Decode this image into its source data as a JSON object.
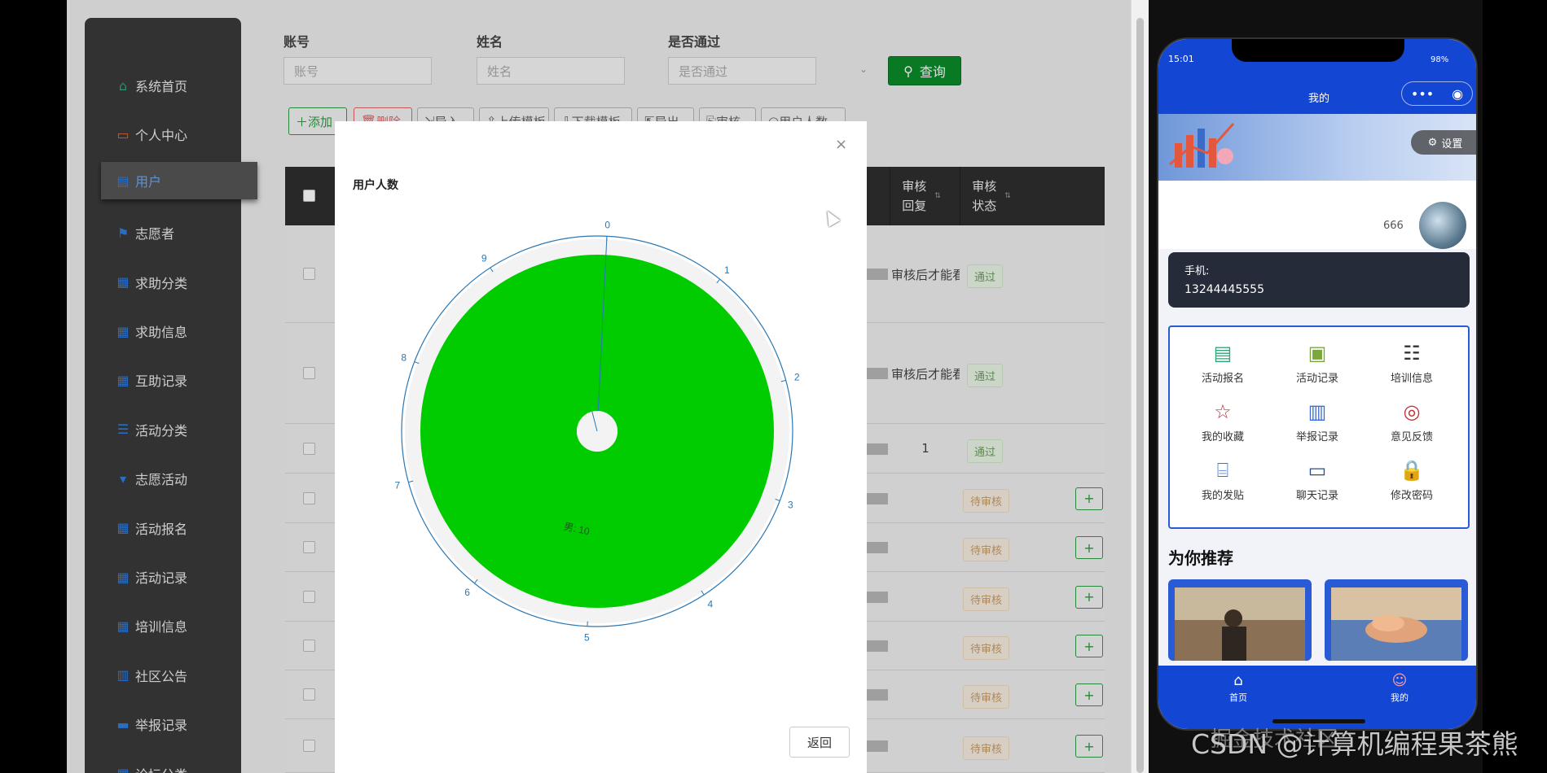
{
  "admin": {
    "sidebar": {
      "items": [
        {
          "label": "系统首页",
          "icon": "home-icon"
        },
        {
          "label": "个人中心",
          "icon": "id-card-icon"
        },
        {
          "label": "用户",
          "icon": "briefcase-icon"
        },
        {
          "label": "志愿者",
          "icon": "flag-icon"
        },
        {
          "label": "求助分类",
          "icon": "grid-icon"
        },
        {
          "label": "求助信息",
          "icon": "grid-icon"
        },
        {
          "label": "互助记录",
          "icon": "grid-icon"
        },
        {
          "label": "活动分类",
          "icon": "sliders-icon"
        },
        {
          "label": "志愿活动",
          "icon": "badge-icon"
        },
        {
          "label": "活动报名",
          "icon": "grid-icon"
        },
        {
          "label": "活动记录",
          "icon": "grid-icon"
        },
        {
          "label": "培训信息",
          "icon": "grid-icon"
        },
        {
          "label": "社区公告",
          "icon": "bar-chart-icon"
        },
        {
          "label": "举报记录",
          "icon": "monitor-icon"
        },
        {
          "label": "论坛分类",
          "icon": "grid-icon"
        }
      ]
    },
    "filters": {
      "account_label": "账号",
      "account_placeholder": "账号",
      "name_label": "姓名",
      "name_placeholder": "姓名",
      "pass_label": "是否通过",
      "pass_placeholder": "是否通过",
      "search_label": "查询"
    },
    "toolbar": {
      "add": "添加",
      "delete": "删除",
      "import": "导入",
      "upload_template": "上传模板",
      "download_template": "下载模板",
      "export": "导出",
      "audit": "审核",
      "user_count": "用户人数"
    },
    "table": {
      "headers": {
        "audit_reply": "审核回复",
        "audit_status": "审核状态"
      },
      "rows": [
        {
          "reply": "审核后才能看",
          "status": "通过"
        },
        {
          "reply": "审核后才能看",
          "status": "通过"
        },
        {
          "reply": "1",
          "status": "通过"
        },
        {
          "reply": "",
          "status": "待审核"
        },
        {
          "reply": "",
          "status": "待审核"
        },
        {
          "reply": "",
          "status": "待审核"
        },
        {
          "reply": "",
          "status": "待审核"
        },
        {
          "reply": "",
          "status": "待审核"
        },
        {
          "reply": "",
          "status": "待审核"
        }
      ]
    }
  },
  "modal": {
    "title": "用户人数",
    "close": "×",
    "back": "返回"
  },
  "chart_data": {
    "type": "pie",
    "title": "用户人数",
    "categories": [
      "男"
    ],
    "values": [
      10
    ],
    "slice_label": "男: 10",
    "angle_axis_ticks": [
      "0",
      "1",
      "2",
      "3",
      "4",
      "5",
      "6",
      "7",
      "8",
      "9"
    ],
    "slice_color": "#00cc00",
    "axis_color": "#2a78b5"
  },
  "phone": {
    "time": "15:01",
    "battery": "98%",
    "title": "我的",
    "capsule_more": "•••",
    "capsule_close": "◉",
    "settings": "设置",
    "username": "666",
    "phone_label": "手机:",
    "phone_value": "13244445555",
    "menu": [
      {
        "label": "活动报名",
        "icon": "document-icon",
        "color": "#2fa57a"
      },
      {
        "label": "活动记录",
        "icon": "bag-icon",
        "color": "#7aa83a"
      },
      {
        "label": "培训信息",
        "icon": "list-icon",
        "color": "#333333"
      },
      {
        "label": "我的收藏",
        "icon": "star-icon",
        "color": "#c0323a"
      },
      {
        "label": "举报记录",
        "icon": "report-icon",
        "color": "#3b6fd8"
      },
      {
        "label": "意见反馈",
        "icon": "feedback-icon",
        "color": "#c0323a"
      },
      {
        "label": "我的发贴",
        "icon": "scan-icon",
        "color": "#3b6fd8"
      },
      {
        "label": "聊天记录",
        "icon": "chat-card-icon",
        "color": "#2a4e8c"
      },
      {
        "label": "修改密码",
        "icon": "lock-icon",
        "color": "#d8606a"
      }
    ],
    "recommend_title": "为你推荐",
    "tabs": [
      {
        "label": "首页",
        "icon": "home-icon"
      },
      {
        "label": "我的",
        "icon": "person-icon"
      }
    ]
  },
  "watermark": "CSDN @计算机编程果茶熊",
  "watermark2": "掘金技术社区"
}
